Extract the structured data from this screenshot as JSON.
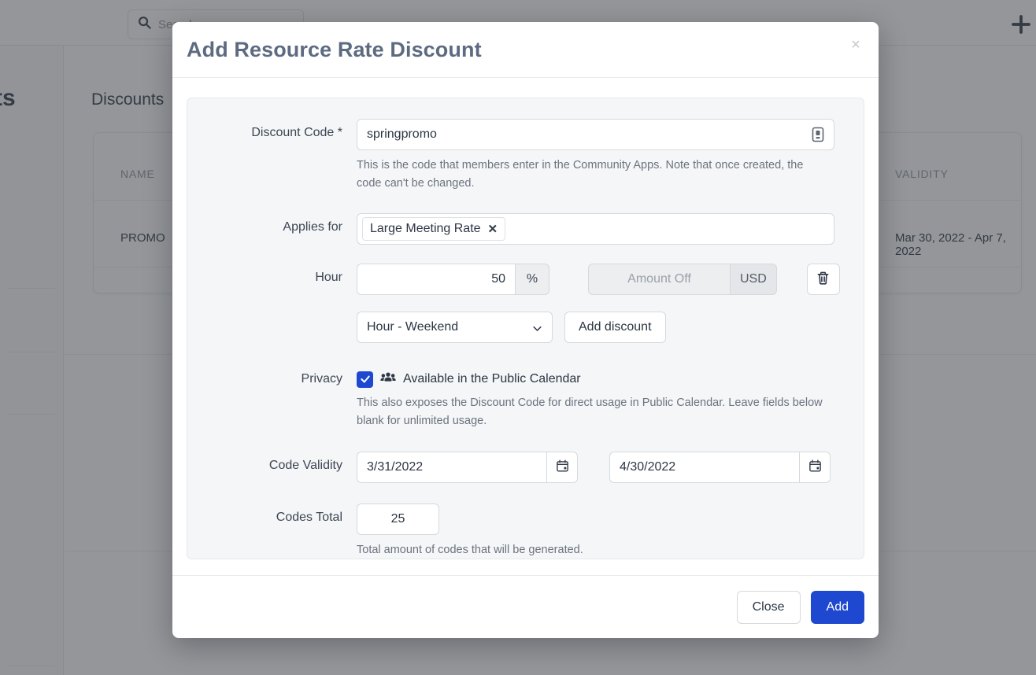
{
  "background": {
    "search": {
      "placeholder": "Search...",
      "icon": "search-icon"
    },
    "add_icon": "plus-icon",
    "page_title": "ucts",
    "section_title": "Discounts",
    "table": {
      "columns": [
        "NAME",
        "VALIDITY"
      ],
      "rows": [
        {
          "name": "PROMO",
          "validity": "Mar 30, 2022 - Apr 7, 2022"
        }
      ]
    }
  },
  "modal": {
    "title": "Add Resource Rate Discount",
    "close_icon": "close-icon",
    "close_label": "×",
    "fields": {
      "discount_code": {
        "label": "Discount Code *",
        "value": "springpromo",
        "placeholder": "",
        "action_icon": "generate-code-icon",
        "hint": "This is the code that members enter in the Community Apps. Note that once created, the code can't be changed."
      },
      "applies_for": {
        "label": "Applies for",
        "chips": [
          {
            "label": "Large Meeting Rate",
            "remove_icon": "close-icon"
          }
        ]
      },
      "hour": {
        "label": "Hour",
        "percent_value": "50",
        "percent_suffix": "%",
        "amount_placeholder": "Amount Off",
        "amount_value": "",
        "currency_suffix": "USD",
        "delete_icon": "trash-icon",
        "select_value": "Hour - Weekend",
        "select_options": [
          "Hour - Weekend"
        ],
        "select_icon": "chevron-down-icon",
        "add_discount_label": "Add discount"
      },
      "privacy": {
        "label": "Privacy",
        "checkbox_checked": true,
        "checkbox_icon": "check-icon",
        "group_icon": "users-icon",
        "checkbox_label": "Available in the Public Calendar",
        "hint": "This also exposes the Discount Code for direct usage in Public Calendar. Leave fields below blank for unlimited usage."
      },
      "code_validity": {
        "label": "Code Validity",
        "start_value": "3/31/2022",
        "end_value": "4/30/2022",
        "calendar_icon": "calendar-icon"
      },
      "codes_total": {
        "label": "Codes Total",
        "value": "25",
        "hint": "Total amount of codes that will be generated."
      }
    },
    "footer": {
      "close_label": "Close",
      "add_label": "Add"
    }
  },
  "colors": {
    "accent": "#1f48d0",
    "title": "#5d6b80",
    "panel_bg": "#f5f6f7",
    "text": "#2c3644",
    "muted": "#6b7380"
  }
}
